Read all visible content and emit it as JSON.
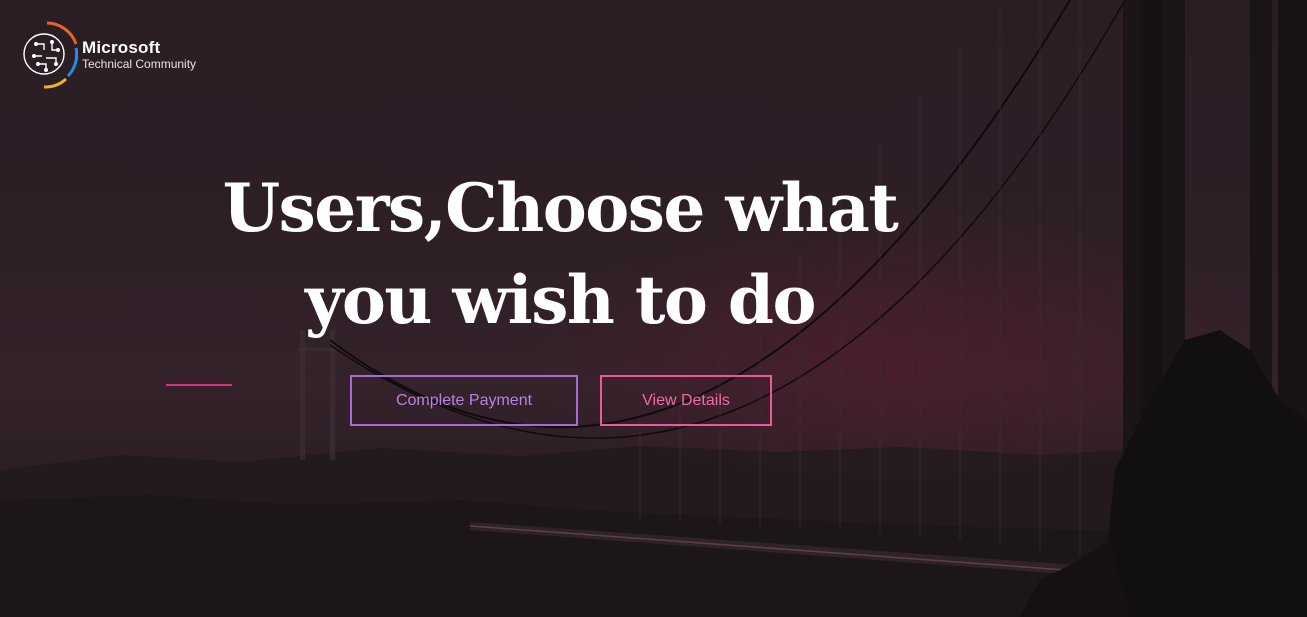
{
  "brand": {
    "name_line1": "Microsoft",
    "name_line2": "Technical Community",
    "logo_icon": "circuit-head-logo-icon"
  },
  "hero": {
    "headline_line1": "Users,Choose what",
    "headline_line2": "you wish to do",
    "background": "suspension-bridge-dusk-photo"
  },
  "actions": {
    "primary_label": "Complete Payment",
    "secondary_label": "View Details"
  },
  "colors": {
    "primary_button": "#a86bd1",
    "secondary_button": "#ea5a9a",
    "accent_line": "#d6337f",
    "background": "#2a1d24"
  }
}
